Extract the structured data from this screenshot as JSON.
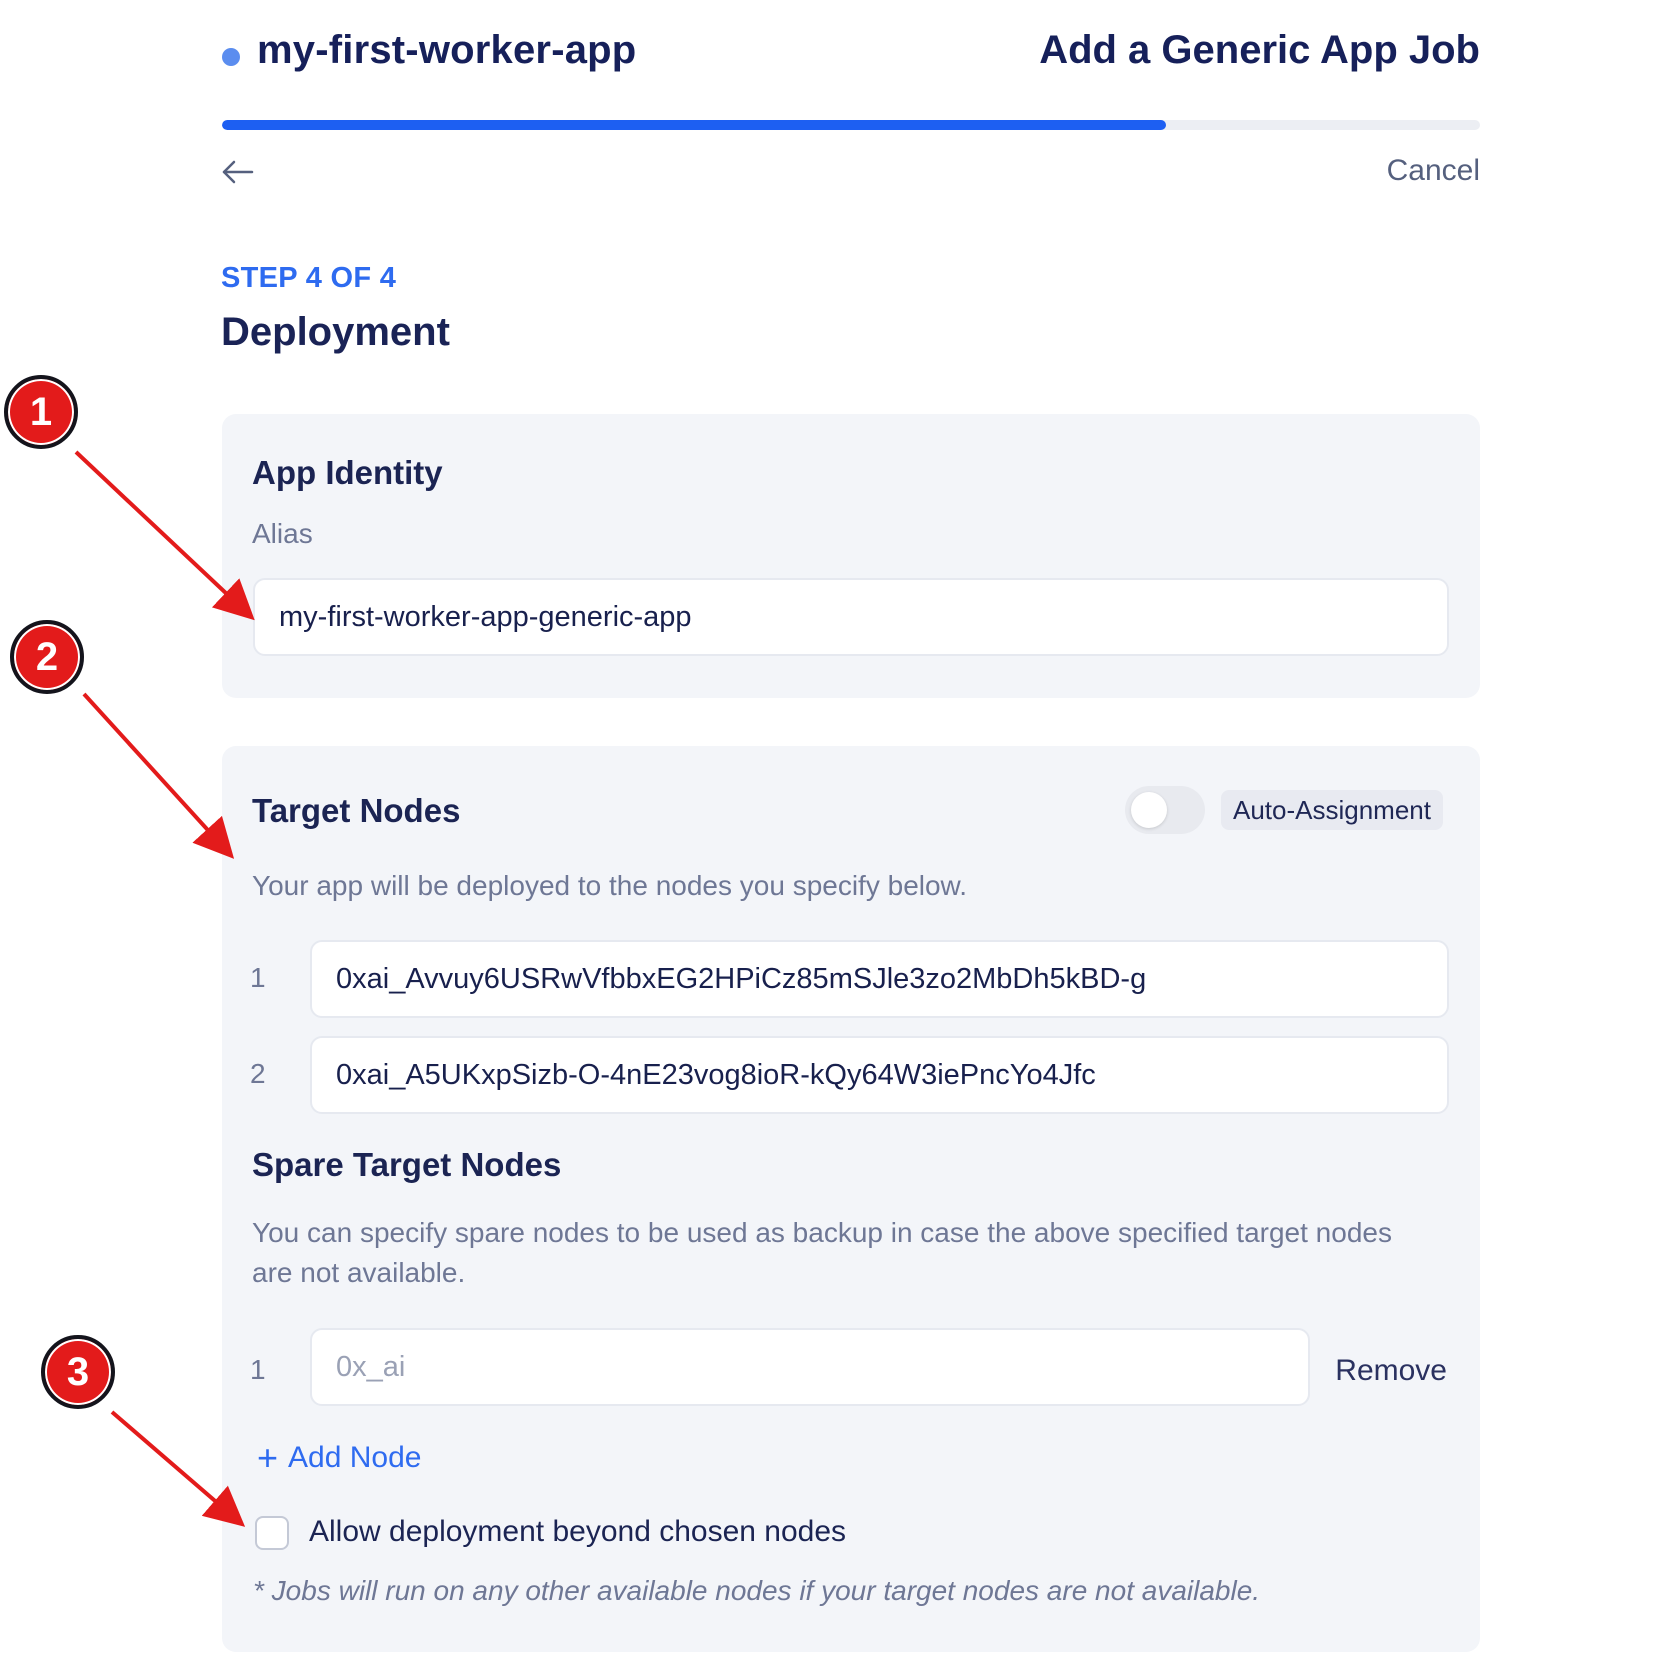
{
  "header": {
    "app_name": "my-first-worker-app",
    "page_title": "Add a Generic App Job",
    "cancel_label": "Cancel",
    "progress_fraction": 0.75,
    "back_icon": "arrow-left-icon"
  },
  "step": {
    "label": "STEP 4 OF 4",
    "title": "Deployment"
  },
  "app_identity": {
    "heading": "App Identity",
    "alias_label": "Alias",
    "alias_value": "my-first-worker-app-generic-app"
  },
  "target_nodes": {
    "heading": "Target Nodes",
    "auto_assignment_label": "Auto-Assignment",
    "auto_assignment_on": false,
    "description": "Your app will be deployed to the nodes you specify below.",
    "nodes": [
      {
        "index": "1",
        "value": "0xai_Avvuy6USRwVfbbxEG2HPiCz85mSJle3zo2MbDh5kBD-g"
      },
      {
        "index": "2",
        "value": "0xai_A5UKxpSizb-O-4nE23vog8ioR-kQy64W3iePncYo4Jfc"
      }
    ]
  },
  "spare_nodes": {
    "heading": "Spare Target Nodes",
    "description_line1": "You can specify spare nodes to be used as backup in case the above specified target nodes",
    "description_line2": "are not available.",
    "nodes": [
      {
        "index": "1",
        "placeholder": "0x_ai",
        "value": ""
      }
    ],
    "remove_label": "Remove",
    "add_node_label": "Add Node",
    "add_icon": "plus-icon"
  },
  "beyond": {
    "checkbox_label": "Allow deployment beyond chosen nodes",
    "checked": false,
    "footnote": "* Jobs will run on any other available nodes if your target nodes are not available."
  },
  "annotations": {
    "markers": [
      "1",
      "2",
      "3"
    ],
    "color": "#e31b1b"
  },
  "colors": {
    "accent": "#1d5ff2",
    "link": "#2e6bf0",
    "text_dark": "#16205a",
    "card_bg": "#f3f5f9"
  }
}
